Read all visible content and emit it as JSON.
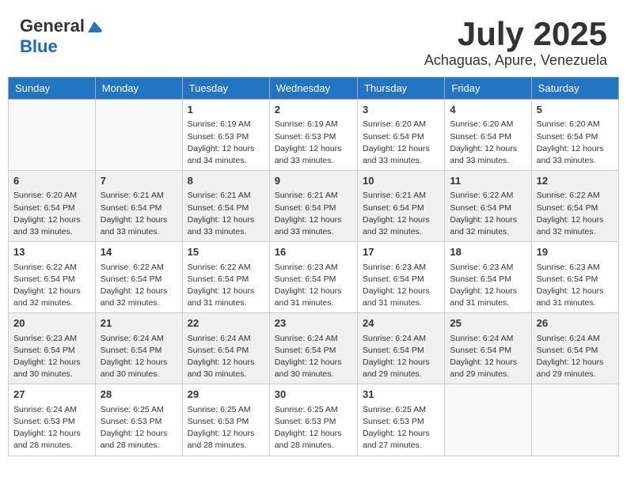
{
  "logo": {
    "general": "General",
    "blue": "Blue"
  },
  "title": {
    "month": "July 2025",
    "location": "Achaguas, Apure, Venezuela"
  },
  "headers": [
    "Sunday",
    "Monday",
    "Tuesday",
    "Wednesday",
    "Thursday",
    "Friday",
    "Saturday"
  ],
  "weeks": [
    [
      {
        "day": "",
        "info": ""
      },
      {
        "day": "",
        "info": ""
      },
      {
        "day": "1",
        "info": "Sunrise: 6:19 AM\nSunset: 6:53 PM\nDaylight: 12 hours and 34 minutes."
      },
      {
        "day": "2",
        "info": "Sunrise: 6:19 AM\nSunset: 6:53 PM\nDaylight: 12 hours and 33 minutes."
      },
      {
        "day": "3",
        "info": "Sunrise: 6:20 AM\nSunset: 6:54 PM\nDaylight: 12 hours and 33 minutes."
      },
      {
        "day": "4",
        "info": "Sunrise: 6:20 AM\nSunset: 6:54 PM\nDaylight: 12 hours and 33 minutes."
      },
      {
        "day": "5",
        "info": "Sunrise: 6:20 AM\nSunset: 6:54 PM\nDaylight: 12 hours and 33 minutes."
      }
    ],
    [
      {
        "day": "6",
        "info": "Sunrise: 6:20 AM\nSunset: 6:54 PM\nDaylight: 12 hours and 33 minutes."
      },
      {
        "day": "7",
        "info": "Sunrise: 6:21 AM\nSunset: 6:54 PM\nDaylight: 12 hours and 33 minutes."
      },
      {
        "day": "8",
        "info": "Sunrise: 6:21 AM\nSunset: 6:54 PM\nDaylight: 12 hours and 33 minutes."
      },
      {
        "day": "9",
        "info": "Sunrise: 6:21 AM\nSunset: 6:54 PM\nDaylight: 12 hours and 33 minutes."
      },
      {
        "day": "10",
        "info": "Sunrise: 6:21 AM\nSunset: 6:54 PM\nDaylight: 12 hours and 32 minutes."
      },
      {
        "day": "11",
        "info": "Sunrise: 6:22 AM\nSunset: 6:54 PM\nDaylight: 12 hours and 32 minutes."
      },
      {
        "day": "12",
        "info": "Sunrise: 6:22 AM\nSunset: 6:54 PM\nDaylight: 12 hours and 32 minutes."
      }
    ],
    [
      {
        "day": "13",
        "info": "Sunrise: 6:22 AM\nSunset: 6:54 PM\nDaylight: 12 hours and 32 minutes."
      },
      {
        "day": "14",
        "info": "Sunrise: 6:22 AM\nSunset: 6:54 PM\nDaylight: 12 hours and 32 minutes."
      },
      {
        "day": "15",
        "info": "Sunrise: 6:22 AM\nSunset: 6:54 PM\nDaylight: 12 hours and 31 minutes."
      },
      {
        "day": "16",
        "info": "Sunrise: 6:23 AM\nSunset: 6:54 PM\nDaylight: 12 hours and 31 minutes."
      },
      {
        "day": "17",
        "info": "Sunrise: 6:23 AM\nSunset: 6:54 PM\nDaylight: 12 hours and 31 minutes."
      },
      {
        "day": "18",
        "info": "Sunrise: 6:23 AM\nSunset: 6:54 PM\nDaylight: 12 hours and 31 minutes."
      },
      {
        "day": "19",
        "info": "Sunrise: 6:23 AM\nSunset: 6:54 PM\nDaylight: 12 hours and 31 minutes."
      }
    ],
    [
      {
        "day": "20",
        "info": "Sunrise: 6:23 AM\nSunset: 6:54 PM\nDaylight: 12 hours and 30 minutes."
      },
      {
        "day": "21",
        "info": "Sunrise: 6:24 AM\nSunset: 6:54 PM\nDaylight: 12 hours and 30 minutes."
      },
      {
        "day": "22",
        "info": "Sunrise: 6:24 AM\nSunset: 6:54 PM\nDaylight: 12 hours and 30 minutes."
      },
      {
        "day": "23",
        "info": "Sunrise: 6:24 AM\nSunset: 6:54 PM\nDaylight: 12 hours and 30 minutes."
      },
      {
        "day": "24",
        "info": "Sunrise: 6:24 AM\nSunset: 6:54 PM\nDaylight: 12 hours and 29 minutes."
      },
      {
        "day": "25",
        "info": "Sunrise: 6:24 AM\nSunset: 6:54 PM\nDaylight: 12 hours and 29 minutes."
      },
      {
        "day": "26",
        "info": "Sunrise: 6:24 AM\nSunset: 6:54 PM\nDaylight: 12 hours and 29 minutes."
      }
    ],
    [
      {
        "day": "27",
        "info": "Sunrise: 6:24 AM\nSunset: 6:53 PM\nDaylight: 12 hours and 28 minutes."
      },
      {
        "day": "28",
        "info": "Sunrise: 6:25 AM\nSunset: 6:53 PM\nDaylight: 12 hours and 28 minutes."
      },
      {
        "day": "29",
        "info": "Sunrise: 6:25 AM\nSunset: 6:53 PM\nDaylight: 12 hours and 28 minutes."
      },
      {
        "day": "30",
        "info": "Sunrise: 6:25 AM\nSunset: 6:53 PM\nDaylight: 12 hours and 28 minutes."
      },
      {
        "day": "31",
        "info": "Sunrise: 6:25 AM\nSunset: 6:53 PM\nDaylight: 12 hours and 27 minutes."
      },
      {
        "day": "",
        "info": ""
      },
      {
        "day": "",
        "info": ""
      }
    ]
  ]
}
